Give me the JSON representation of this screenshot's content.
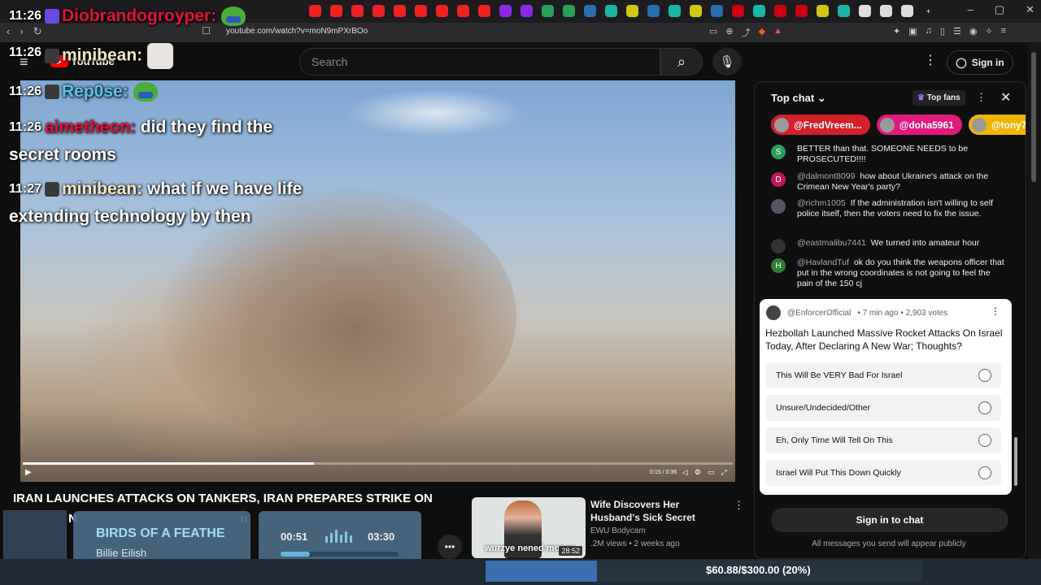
{
  "browser": {
    "url": "youtube.com/watch?v=moN9mPXrBOo",
    "window_controls": [
      "–",
      "▢",
      "✕"
    ],
    "nav": [
      "‹",
      "›",
      "↻"
    ],
    "tab_colors": [
      "#e22",
      "#e22",
      "#e22",
      "#e22",
      "#e22",
      "#e22",
      "#e22",
      "#e22",
      "#e22",
      "#8a2be2",
      "#8a2be2",
      "#2a9d5a",
      "#2a9d5a",
      "#2a6db0",
      "#19b6a6",
      "#d4c514",
      "#2a6db0",
      "#19b6a6",
      "#d4c514",
      "#2a6db0",
      "#c01",
      "#19b6a6",
      "#c01",
      "#c01",
      "#d4c514",
      "#19b6a6",
      "#ddd",
      "#ddd",
      "#ddd"
    ],
    "new_tab": "+"
  },
  "youtube": {
    "search_placeholder": "Search",
    "sign_in": "Sign in",
    "logo": "YouTube"
  },
  "stream_overlay": {
    "lines": [
      {
        "time": "11:26",
        "user": "Diobrandogroyper:",
        "user_color": "#e0123a",
        "text": ""
      },
      {
        "time": "11:26",
        "user": "minibean:",
        "user_color": "#f3e7c3",
        "text": ""
      },
      {
        "time": "11:26",
        "user": "Rep0se:",
        "user_color": "#5ac6e6",
        "text": ""
      },
      {
        "time": "11:26",
        "user": "aimetheon:",
        "user_color": "#e0123a",
        "text": "did they find the"
      },
      {
        "time": "",
        "user": "",
        "user_color": "#fff",
        "text": "secret rooms"
      },
      {
        "time": "11:27",
        "user": "minibean:",
        "user_color": "#f3e7c3",
        "text": "what if we have life"
      },
      {
        "time": "",
        "user": "",
        "user_color": "#fff",
        "text": "extending technology by then"
      }
    ]
  },
  "player": {
    "time": "0:15 / 0:36",
    "progress": 0.41
  },
  "video": {
    "title_line1": "IRAN LAUNCHES ATTACKS ON TANKERS, IRAN PREPARES STRIKE ON",
    "title_line2": "N",
    "title_line2_end": "n"
  },
  "now_playing": {
    "song": "BIRDS OF A FEATHE",
    "artist": "Billie Eilish",
    "current": "00:51",
    "total": "03:30",
    "progress": 0.25
  },
  "recommended": {
    "title": "Wife Discovers Her Husband's Sick Secret",
    "channel": "EWU Bodycam",
    "meta": ".2M views • 2 weeks ago",
    "duration": "28:52",
    "caption": "wurzye nened money"
  },
  "chat": {
    "mode": "Top chat",
    "top_fans": "Top fans",
    "pills": [
      {
        "name": "@FredVreem...",
        "color": "#d3202b"
      },
      {
        "name": "@doha5961",
        "color": "#e0197d"
      },
      {
        "name": "@tony76",
        "color": "#f0b400"
      }
    ],
    "messages": [
      {
        "author": "",
        "text": "BETTER than that. SOMEONE NEEDS to be PROSECUTED!!!!",
        "avatar": "S",
        "color": "#2a9d5a"
      },
      {
        "author": "@dalmont8099",
        "text": "how about Ukraine's attack on the Crimean New Year's party?",
        "avatar": "D",
        "color": "#c2185b"
      },
      {
        "author": "@richm1005",
        "text": "If the administration isn't willing to self police itself, then the voters need to fix the issue.",
        "avatar": "",
        "color": "#556"
      },
      {
        "author": "@eastmalibu7441",
        "text": "We turned into amateur hour",
        "avatar": "",
        "color": "#333"
      },
      {
        "author": "@HavlandTuf",
        "text": "ok do you think the weapons officer that put in the wrong coordinates is not going to feel the pain of the 150 cj",
        "avatar": "H",
        "color": "#2e7d32"
      }
    ],
    "poll": {
      "author": "@EnforcerOfficial",
      "meta": "• 7 min ago • 2,903 votes",
      "question": "Hezbollah Launched Massive Rocket Attacks On Israel Today, After Declaring A New War; Thoughts?",
      "options": [
        "This Will Be VERY Bad For Israel",
        "Unsure/Undecided/Other",
        "Eh, Only Time Will Tell On This",
        "Israel Will Put This Down Quickly"
      ]
    },
    "sign_in_chat": "Sign in to chat",
    "public_note": "All messages you send will appear publicly"
  },
  "taskbar": {
    "money": "$60.88/$300.00 (20%)"
  }
}
